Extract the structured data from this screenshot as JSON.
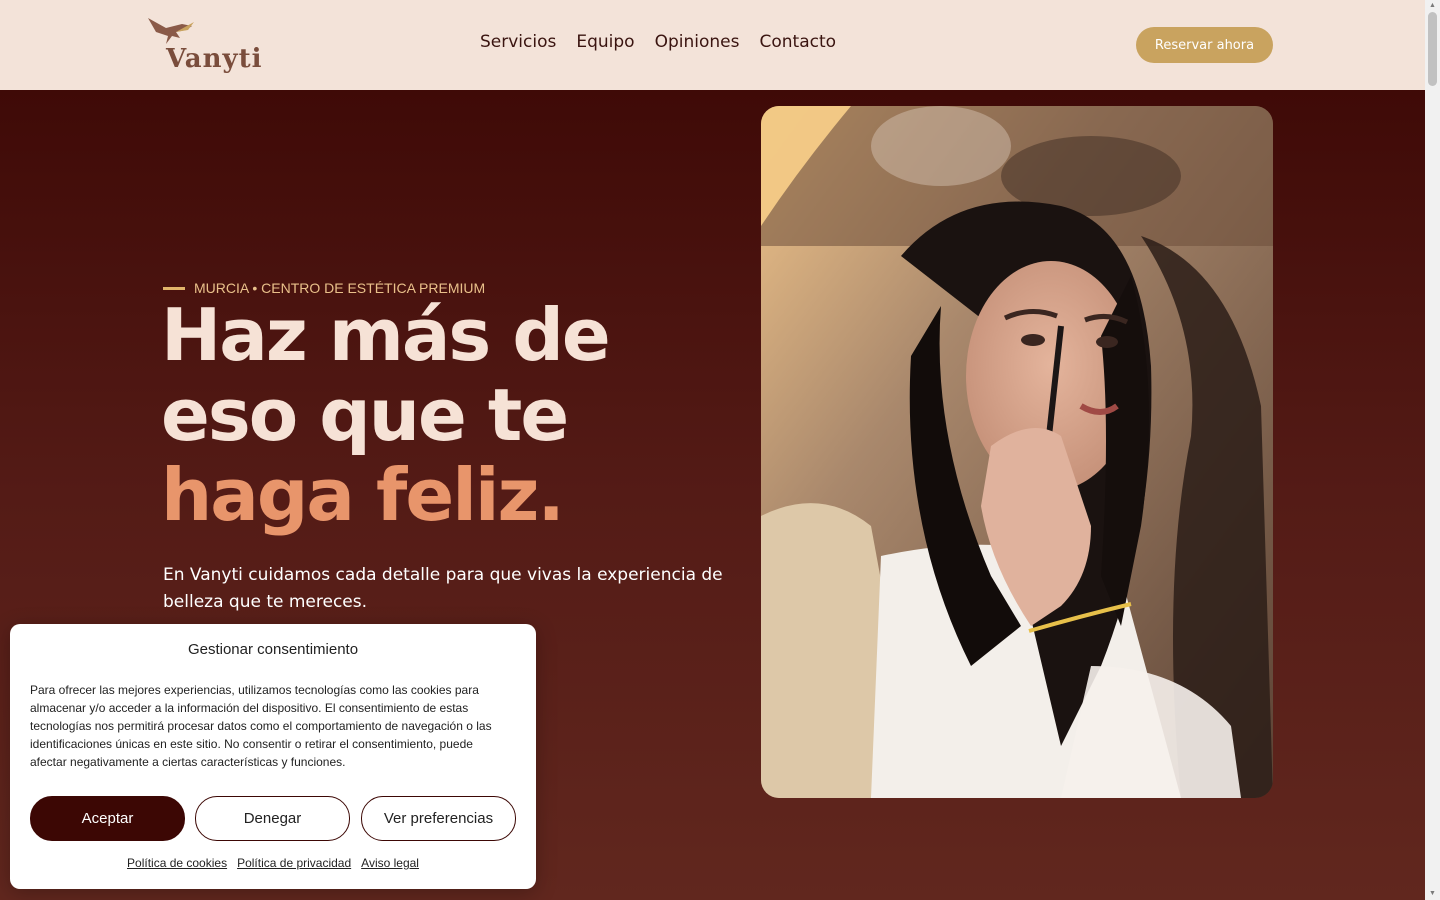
{
  "brand": {
    "name": "Vanyti",
    "accent_color": "#c9a35f",
    "primary_dark": "#3f0a07",
    "accent_text": "#e8956b"
  },
  "nav": {
    "items": [
      {
        "label": "Servicios"
      },
      {
        "label": "Equipo"
      },
      {
        "label": "Opiniones"
      },
      {
        "label": "Contacto"
      }
    ],
    "cta": "Reservar ahora"
  },
  "hero": {
    "kicker": "MURCIA • CENTRO DE ESTÉTICA PREMIUM",
    "headline_line1": "Haz más de",
    "headline_line2": "eso que te",
    "headline_accent": "haga feliz.",
    "lead": "En Vanyti cuidamos cada detalle para que vivas la experiencia de belleza que te mereces.",
    "image_icon": "woman-applying-eyebrow-pencil-photo"
  },
  "consent": {
    "title": "Gestionar consentimiento",
    "text": "Para ofrecer las mejores experiencias, utilizamos tecnologías como las cookies para almacenar y/o acceder a la información del dispositivo. El consentimiento de estas tecnologías nos permitirá procesar datos como el comportamiento de navegación o las identificaciones únicas en este sitio. No consentir o retirar el consentimiento, puede afectar negativamente a ciertas características y funciones.",
    "accept": "Aceptar",
    "deny": "Denegar",
    "preferences": "Ver preferencias",
    "links": [
      {
        "label": "Política de cookies"
      },
      {
        "label": "Política de privacidad"
      },
      {
        "label": "Aviso legal"
      }
    ]
  }
}
